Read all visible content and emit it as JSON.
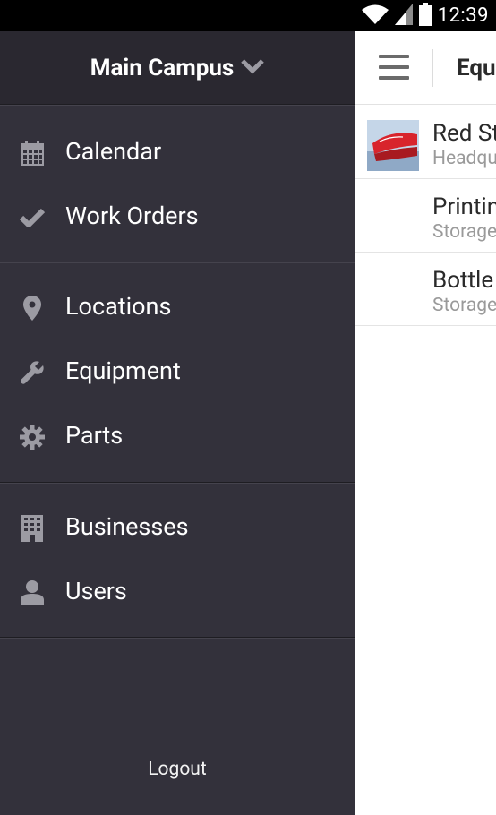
{
  "status_bar": {
    "time": "12:39",
    "icons": [
      "wifi-icon",
      "signal-icon",
      "battery-icon"
    ]
  },
  "drawer": {
    "campus": {
      "label": "Main Campus",
      "icon": "chevron-down-icon"
    },
    "groups": [
      [
        {
          "label": "Calendar",
          "icon": "calendar-icon"
        },
        {
          "label": "Work Orders",
          "icon": "checkmark-icon"
        }
      ],
      [
        {
          "label": "Locations",
          "icon": "map-pin-icon"
        },
        {
          "label": "Equipment",
          "icon": "wrench-icon"
        },
        {
          "label": "Parts",
          "icon": "gear-icon"
        }
      ],
      [
        {
          "label": "Businesses",
          "icon": "building-icon"
        },
        {
          "label": "Users",
          "icon": "user-icon"
        }
      ]
    ],
    "logout_label": "Logout"
  },
  "appbar": {
    "title": "Equi",
    "menu_icon": "hamburger-icon"
  },
  "list": [
    {
      "title": "Red St",
      "subtitle": "Headqua",
      "has_image": true
    },
    {
      "title": "Printin",
      "subtitle": "Storage",
      "has_image": false
    },
    {
      "title": "Bottle",
      "subtitle": "Storage",
      "has_image": false
    }
  ],
  "colors": {
    "drawer_bg": "#33313b",
    "drawer_header_bg": "#2a2830",
    "icon_gray": "#9c9ba3",
    "status_bar_bg": "#000000"
  }
}
